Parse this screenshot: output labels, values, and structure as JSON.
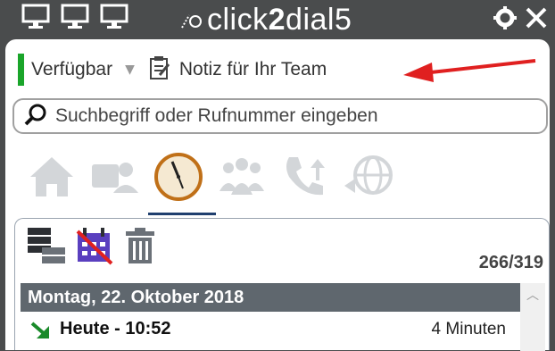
{
  "window": {
    "title_prefix": "click",
    "title_number": "2",
    "title_suffix": "dial5"
  },
  "status": {
    "label": "Verfügbar",
    "color": "#1aa52a"
  },
  "note": {
    "label": "Notiz für Ihr Team"
  },
  "search": {
    "placeholder": "Suchbegriff oder Rufnummer eingeben"
  },
  "tabs": [
    {
      "name": "home",
      "icon": "house-icon",
      "active": false
    },
    {
      "name": "contacts",
      "icon": "contact-card-icon",
      "active": false
    },
    {
      "name": "history",
      "icon": "clock-icon",
      "active": true
    },
    {
      "name": "team",
      "icon": "group-icon",
      "active": false
    },
    {
      "name": "forwarding",
      "icon": "phone-forward-icon",
      "active": false
    },
    {
      "name": "web",
      "icon": "globe-icon",
      "active": false
    }
  ],
  "history": {
    "counter": "266/319",
    "day_header": "Montag, 22. Oktober 2018",
    "calls": [
      {
        "title": "Heute - 10:52",
        "duration": "4 Minuten",
        "direction": "incoming"
      }
    ]
  },
  "colors": {
    "titlebar": "#4a4c4d",
    "accent_arrow": "#e02020",
    "tab_underline": "#1f3f6e",
    "header_bg": "#5f676e"
  }
}
